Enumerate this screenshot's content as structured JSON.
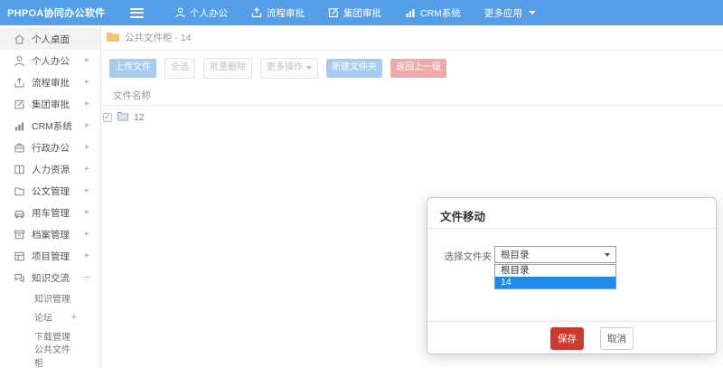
{
  "topbar": {
    "brand": "PHPOA协同办公软件",
    "nav": [
      {
        "label": "个人办公",
        "icon": "user-icon"
      },
      {
        "label": "流程审批",
        "icon": "upload-icon"
      },
      {
        "label": "集团审批",
        "icon": "edit-icon"
      },
      {
        "label": "CRM系统",
        "icon": "chart-icon"
      },
      {
        "label": "更多应用",
        "icon": "caret-down-icon"
      }
    ]
  },
  "sidebar": {
    "items": [
      {
        "label": "个人桌面",
        "expand": "",
        "icon": "home-icon",
        "active": true
      },
      {
        "label": "个人办公",
        "expand": "+",
        "icon": "user-icon"
      },
      {
        "label": "流程审批",
        "expand": "+",
        "icon": "upload-icon"
      },
      {
        "label": "集团审批",
        "expand": "+",
        "icon": "edit-icon"
      },
      {
        "label": "CRM系统",
        "expand": "+",
        "icon": "chart-icon"
      },
      {
        "label": "行政办公",
        "expand": "+",
        "icon": "briefcase-icon"
      },
      {
        "label": "人力资源",
        "expand": "+",
        "icon": "book-icon"
      },
      {
        "label": "公文管理",
        "expand": "+",
        "icon": "document-icon"
      },
      {
        "label": "用车管理",
        "expand": "+",
        "icon": "car-icon"
      },
      {
        "label": "档案管理",
        "expand": "+",
        "icon": "archive-icon"
      },
      {
        "label": "项目管理",
        "expand": "+",
        "icon": "project-icon"
      },
      {
        "label": "知识交流",
        "expand": "−",
        "icon": "chat-icon",
        "expanded": true
      }
    ],
    "subitems": [
      {
        "label": "知识管理",
        "expand": ""
      },
      {
        "label": "论坛",
        "expand": "+"
      },
      {
        "label": "下载管理",
        "expand": ""
      },
      {
        "label": "公共文件柜",
        "expand": ""
      }
    ]
  },
  "main": {
    "breadcrumb": "公共文件柜 - 14",
    "toolbar": {
      "upload": "上传文件",
      "select_all": "全选",
      "batch_delete": "批量删除",
      "more_actions": "更多操作",
      "new_folder": "新建文件夹",
      "go_back": "返回上一级"
    },
    "table": {
      "header": "文件名称",
      "rows": [
        {
          "name": "12",
          "checked": true
        }
      ]
    }
  },
  "modal": {
    "title": "文件移动",
    "label": "选择文件夹",
    "select_value": "根目录",
    "options": [
      {
        "label": "根目录",
        "selected": false
      },
      {
        "label": "14",
        "selected": true
      }
    ],
    "save": "保存",
    "cancel": "取消"
  },
  "colors": {
    "topbar_blue": "#559ee8",
    "button_light_blue": "#a8ccf0",
    "button_light_red": "#f0aaa8",
    "save_red": "#cc392e",
    "option_highlight_blue": "#1f8ae6",
    "breadcrumb_folder": "#f2c56d"
  }
}
